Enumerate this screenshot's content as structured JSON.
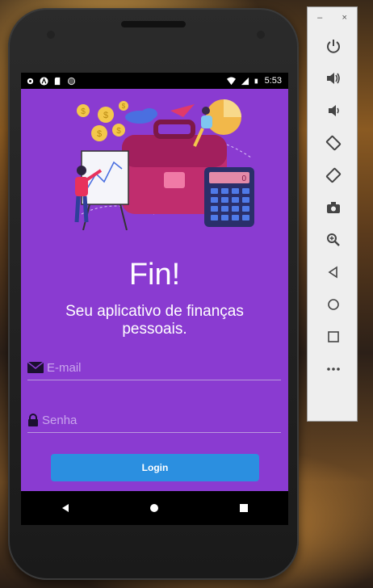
{
  "status_bar": {
    "time": "5:53"
  },
  "app": {
    "title": "Fin!",
    "subtitle": "Seu aplicativo de finanças pessoais.",
    "email": {
      "placeholder": "E-mail",
      "value": ""
    },
    "password": {
      "placeholder": "Senha",
      "value": ""
    },
    "login_label": "Login",
    "calculator_display": "0"
  },
  "emulator_panel": {
    "minimize_label": "–",
    "close_label": "×",
    "buttons": [
      "power-icon",
      "volume-up-icon",
      "volume-down-icon",
      "rotate-left-icon",
      "rotate-right-icon",
      "camera-icon",
      "zoom-icon",
      "back-icon",
      "home-icon",
      "overview-icon",
      "more-icon"
    ]
  },
  "colors": {
    "app_background": "#8a3bd1",
    "login_button": "#2b8fe0",
    "placeholder": "#c9a6ec"
  }
}
